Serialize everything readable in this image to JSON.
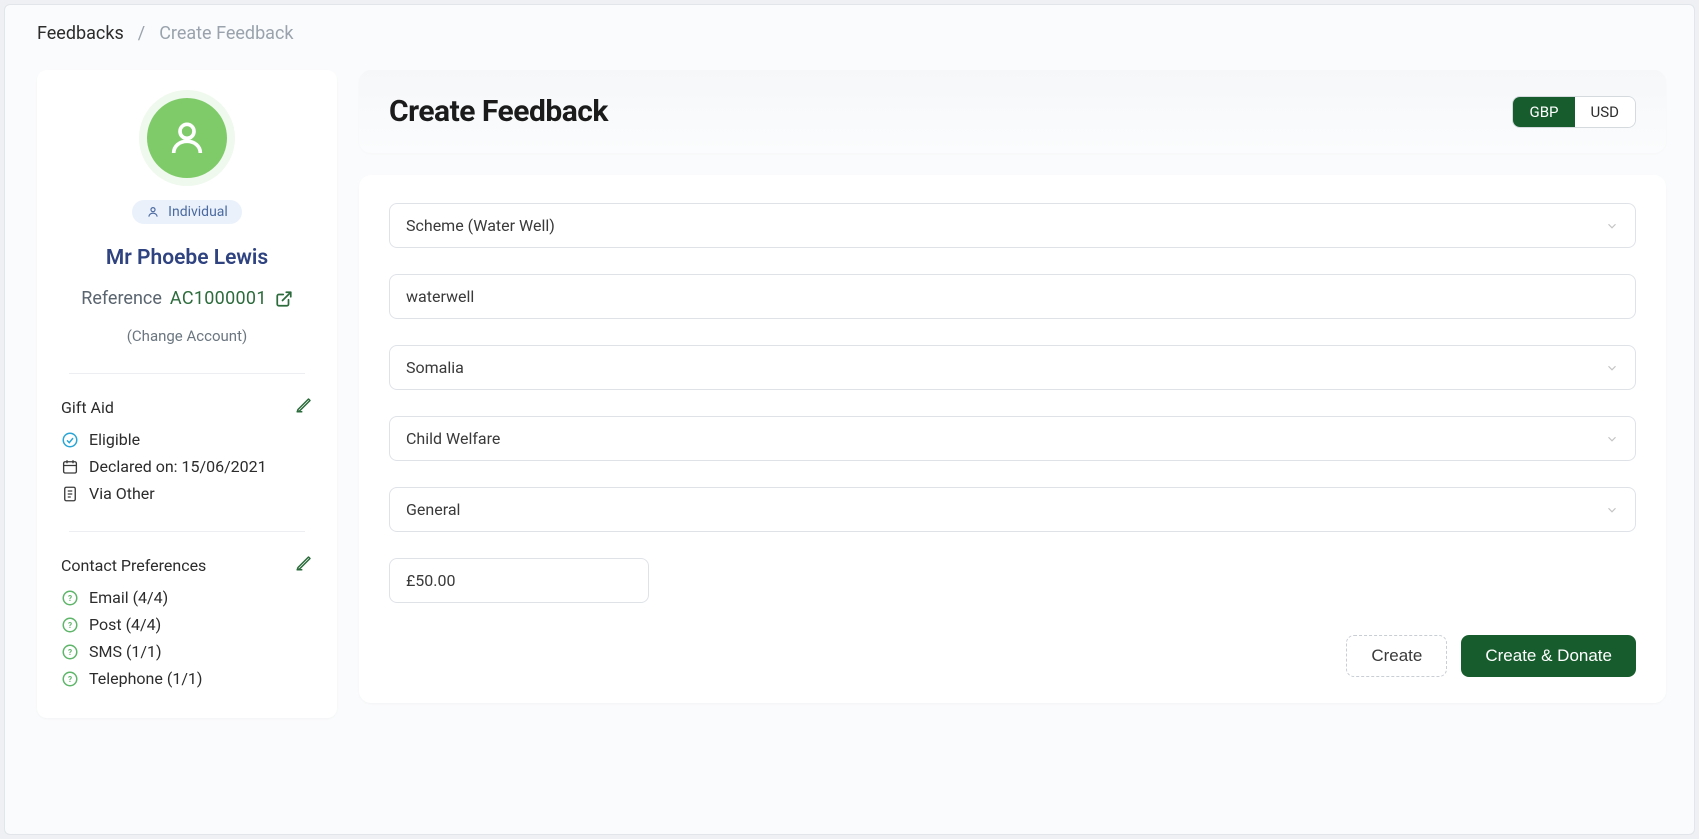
{
  "breadcrumb": {
    "root": "Feedbacks",
    "current": "Create Feedback"
  },
  "header": {
    "title": "Create Feedback",
    "currency": {
      "active": "GBP",
      "inactive": "USD"
    }
  },
  "profile": {
    "type": "Individual",
    "name": "Mr Phoebe Lewis",
    "reference_label": "Reference",
    "reference_value": "AC1000001",
    "change_account": "(Change Account)"
  },
  "gift_aid": {
    "title": "Gift Aid",
    "eligible": "Eligible",
    "declared": "Declared on: 15/06/2021",
    "via": "Via Other"
  },
  "contact_prefs": {
    "title": "Contact Preferences",
    "items": [
      "Email (4/4)",
      "Post (4/4)",
      "SMS (1/1)",
      "Telephone (1/1)"
    ]
  },
  "form": {
    "scheme": "Scheme (Water Well)",
    "text_value": "waterwell",
    "country": "Somalia",
    "category": "Child Welfare",
    "type": "General",
    "amount": "£50.00",
    "create_label": "Create",
    "create_donate_label": "Create & Donate"
  }
}
